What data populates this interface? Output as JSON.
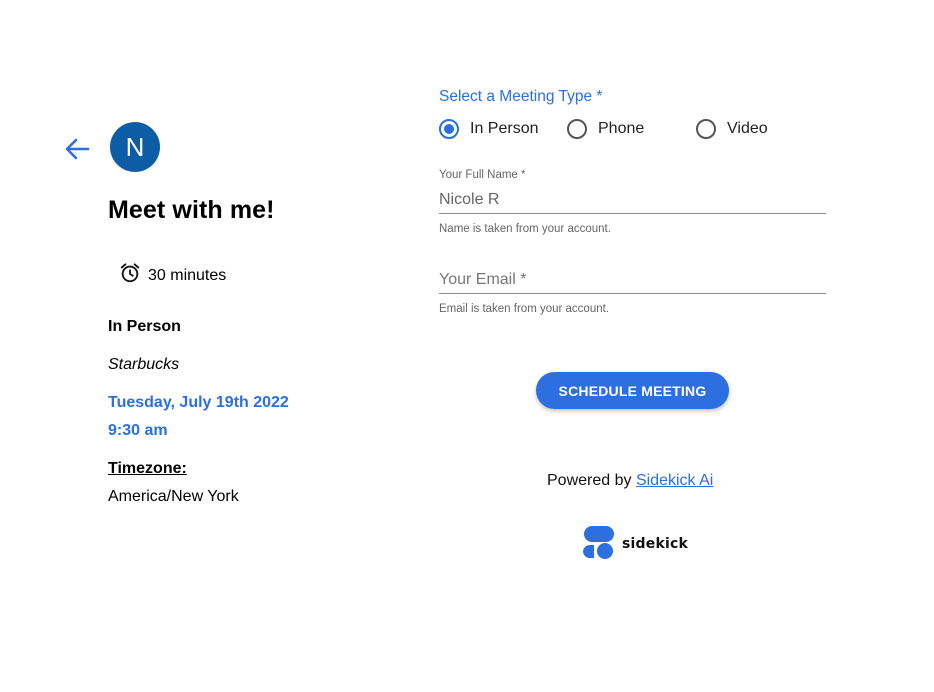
{
  "header": {
    "avatar_initial": "N",
    "title": "Meet with me!"
  },
  "event": {
    "duration": "30 minutes",
    "location_type": "In Person",
    "location_name": "Starbucks",
    "date": "Tuesday, July 19th 2022",
    "time": "9:30 am",
    "timezone_label": "Timezone:",
    "timezone_value": "America/New York"
  },
  "form": {
    "meeting_type_label": "Select a Meeting Type *",
    "meeting_types": [
      {
        "label": "In Person",
        "selected": true
      },
      {
        "label": "Phone",
        "selected": false
      },
      {
        "label": "Video",
        "selected": false
      }
    ],
    "name_label": "Your Full Name *",
    "name_value": "Nicole R",
    "name_helper": "Name is taken from your account.",
    "email_placeholder": "Your Email *",
    "email_helper": "Email is taken from your account.",
    "submit_label": "SCHEDULE MEETING"
  },
  "footer": {
    "powered_prefix": "Powered by ",
    "powered_link": "Sidekick Ai",
    "logo_text": "sidekick"
  },
  "colors": {
    "accent": "#2c6fe0",
    "avatar_bg": "#0d5da6"
  }
}
